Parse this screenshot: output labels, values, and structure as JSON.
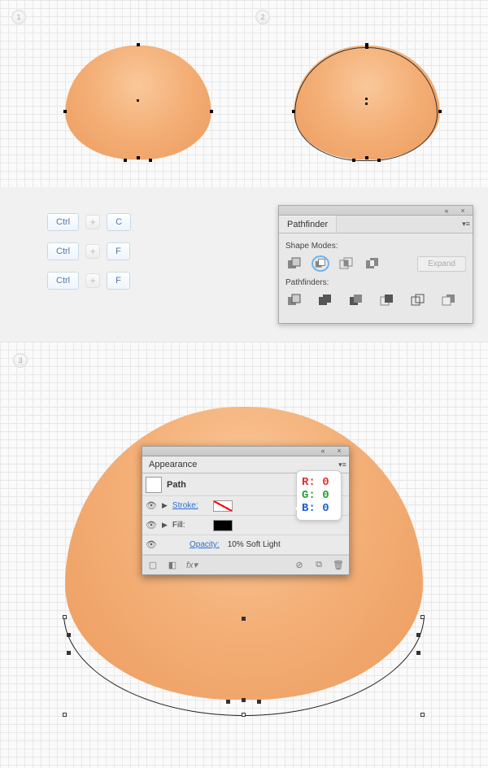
{
  "steps": {
    "s1": "1",
    "s2": "2",
    "s3": "3"
  },
  "shortcuts": {
    "rows": [
      {
        "mod": "Ctrl",
        "key": "C"
      },
      {
        "mod": "Ctrl",
        "key": "F"
      },
      {
        "mod": "Ctrl",
        "key": "F"
      }
    ]
  },
  "pathfinder": {
    "title": "Pathfinder",
    "shape_modes_label": "Shape Modes:",
    "pathfinders_label": "Pathfinders:",
    "expand_label": "Expand",
    "shape_icons": [
      "unite",
      "minus-front",
      "intersect",
      "exclude"
    ],
    "pf_icons": [
      "divide",
      "trim",
      "merge",
      "crop",
      "outline",
      "minus-back"
    ]
  },
  "appearance": {
    "title": "Appearance",
    "path_label": "Path",
    "stroke_label": "Stroke:",
    "fill_label": "Fill:",
    "opacity_label": "Opacity:",
    "opacity_value": "10% Soft Light"
  },
  "rgb": {
    "r": "R: 0",
    "g": "G: 0",
    "b": "B: 0"
  }
}
